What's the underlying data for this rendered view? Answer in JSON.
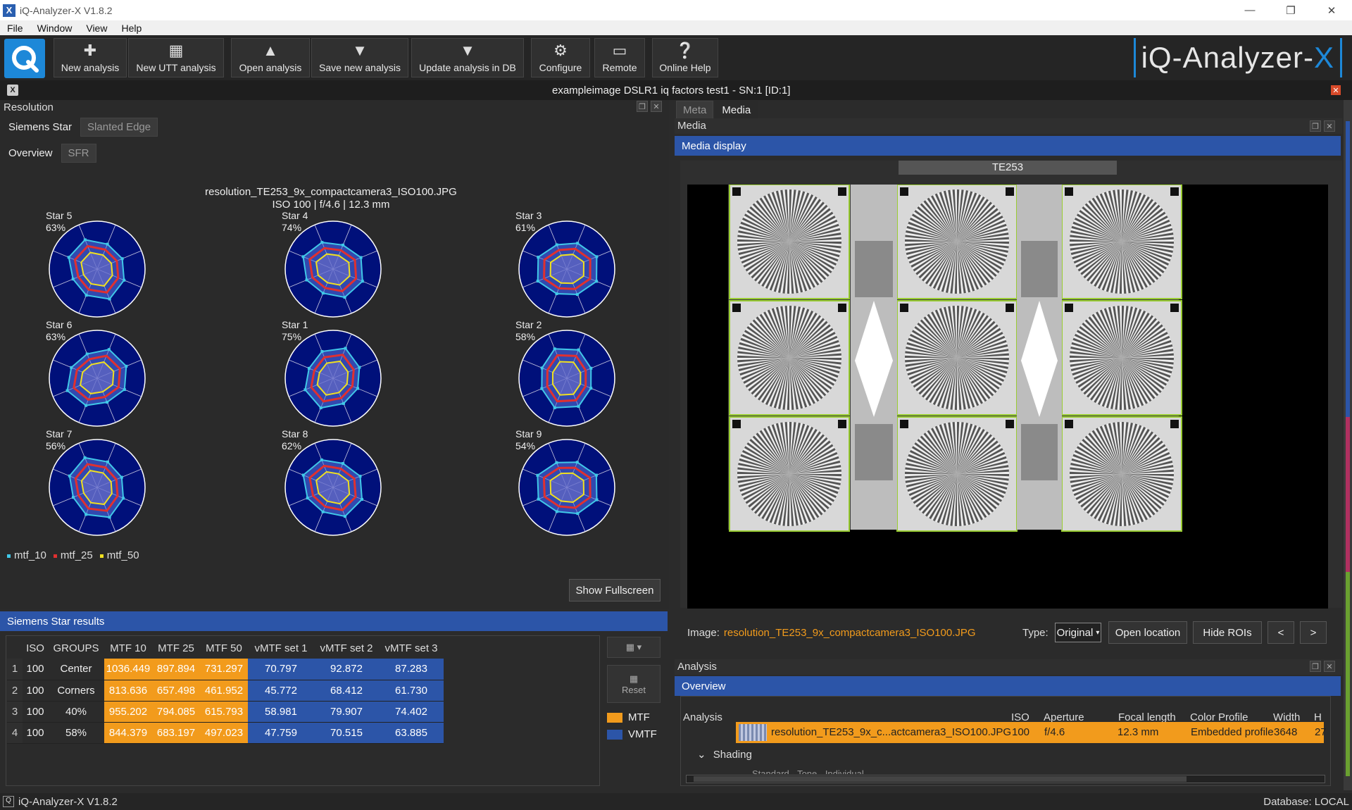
{
  "window": {
    "title": "iQ-Analyzer-X V1.8.2"
  },
  "menu": [
    "File",
    "Window",
    "View",
    "Help"
  ],
  "toolbar": [
    {
      "label": "New analysis",
      "icon": "plus-icon"
    },
    {
      "label": "New UTT analysis",
      "icon": "utt-icon"
    },
    {
      "label": "Open analysis",
      "icon": "open-icon"
    },
    {
      "label": "Save new analysis",
      "icon": "save-icon"
    },
    {
      "label": "Update analysis in DB",
      "icon": "db-update-icon"
    },
    {
      "label": "Configure",
      "icon": "gear-icon"
    },
    {
      "label": "Remote",
      "icon": "monitor-icon"
    },
    {
      "label": "Online Help",
      "icon": "help-icon"
    }
  ],
  "brand": {
    "text": "iQ-Analyzer-",
    "accent": "X"
  },
  "document": {
    "title": "exampleimage DSLR1 iq factors test1 - SN:1 [ID:1]"
  },
  "resolution": {
    "title": "Resolution",
    "tabs": [
      "Siemens Star",
      "Slanted Edge"
    ],
    "subtabs": [
      "Overview",
      "SFR"
    ],
    "chart_file": "resolution_TE253_9x_compactcamera3_ISO100.JPG",
    "chart_info": "ISO 100 | f/4.6 | 12.3 mm",
    "legend": [
      {
        "label": "mtf_10",
        "color": "#40c8e8"
      },
      {
        "label": "mtf_25",
        "color": "#e03030"
      },
      {
        "label": "mtf_50",
        "color": "#f0e020"
      }
    ],
    "show_fullscreen": "Show Fullscreen"
  },
  "stars": [
    {
      "name": "Star 5",
      "pct": "63%"
    },
    {
      "name": "Star 4",
      "pct": "74%"
    },
    {
      "name": "Star 3",
      "pct": "61%"
    },
    {
      "name": "Star 6",
      "pct": "63%"
    },
    {
      "name": "Star 1",
      "pct": "75%"
    },
    {
      "name": "Star 2",
      "pct": "58%"
    },
    {
      "name": "Star 7",
      "pct": "56%"
    },
    {
      "name": "Star 8",
      "pct": "62%"
    },
    {
      "name": "Star 9",
      "pct": "54%"
    }
  ],
  "results": {
    "title": "Siemens Star results",
    "columns": [
      "ISO",
      "GROUPS",
      "MTF 10",
      "MTF 25",
      "MTF 50",
      "vMTF set 1",
      "vMTF set 2",
      "vMTF set 3"
    ],
    "rows": [
      [
        "1",
        "100",
        "Center",
        "1036.449",
        "897.894",
        "731.297",
        "70.797",
        "92.872",
        "87.283"
      ],
      [
        "2",
        "100",
        "Corners",
        "813.636",
        "657.498",
        "461.952",
        "45.772",
        "68.412",
        "61.730"
      ],
      [
        "3",
        "100",
        "40%",
        "955.202",
        "794.085",
        "615.793",
        "58.981",
        "79.907",
        "74.402"
      ],
      [
        "4",
        "100",
        "58%",
        "844.379",
        "683.197",
        "497.023",
        "47.759",
        "70.515",
        "63.885"
      ]
    ],
    "reset": "Reset",
    "legend": [
      {
        "label": "MTF",
        "color": "#f29b1c"
      },
      {
        "label": "VMTF",
        "color": "#2c55a8"
      }
    ]
  },
  "right_tabs": [
    "Meta",
    "Media"
  ],
  "media": {
    "title": "Media",
    "display_title": "Media display",
    "chart_name": "TE253",
    "image_label": "Image:",
    "image_file": "resolution_TE253_9x_compactcamera3_ISO100.JPG",
    "type_label": "Type:",
    "type_value": "Original",
    "open_location": "Open location",
    "hide_rois": "Hide ROIs",
    "prev": "<",
    "next": ">"
  },
  "analysis": {
    "title": "Analysis",
    "overview": "Overview",
    "columns": [
      "Analysis",
      "ISO",
      "Aperture",
      "Focal length",
      "Color Profile",
      "Width",
      "H"
    ],
    "row": [
      "resolution_TE253_9x_c...actcamera3_ISO100.JPG",
      "100",
      "f/4.6",
      "12.3 mm",
      "Embedded profile",
      "3648",
      "27"
    ],
    "group": "Shading",
    "group_child": "Standard - Tone - Individual"
  },
  "status": {
    "left": "iQ-Analyzer-X V1.8.2",
    "right": "Database: LOCAL"
  }
}
